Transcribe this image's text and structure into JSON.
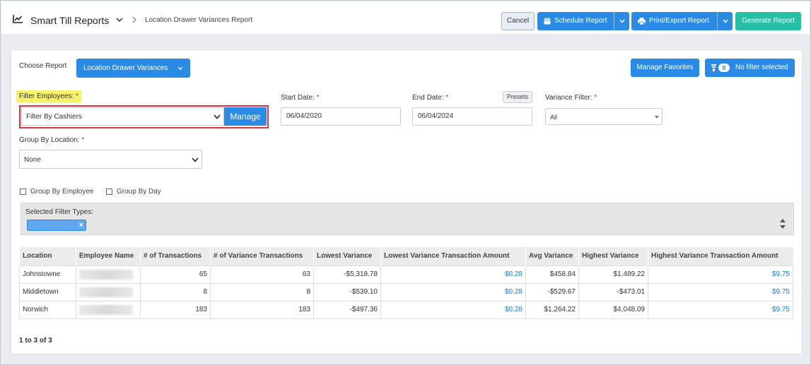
{
  "header": {
    "app_title": "Smart Till Reports",
    "breadcrumb": "Location Drawer Variances Report",
    "cancel_label": "Cancel",
    "schedule_label": "Schedule Report",
    "print_label": "Print/Export Report",
    "generate_label": "Generate Report"
  },
  "report": {
    "choose_label": "Choose Report",
    "selected_report": "Location Drawer Variances",
    "manage_favorites_label": "Manage Favorites",
    "filter_count": "0",
    "filter_status": "No filter selected"
  },
  "form": {
    "filter_employees_label": "Filter Employees:",
    "filter_employees_value": "Filter By Cashiers",
    "manage_label": "Manage",
    "start_date_label": "Start Date:",
    "start_date_value": "06/04/2020",
    "end_date_label": "End Date:",
    "end_date_value": "06/04/2024",
    "presets_label": "Presets",
    "variance_filter_label": "Variance Filter:",
    "variance_filter_value": "All",
    "group_by_location_label": "Group By Location:",
    "group_by_location_value": "None",
    "required_mark": "*",
    "group_by_employee_label": "Group By Employee",
    "group_by_day_label": "Group By Day",
    "selected_filter_types_label": "Selected Filter Types:",
    "tag_remove": "×"
  },
  "table": {
    "columns": [
      "Location",
      "Employee Name",
      "# of Transactions",
      "# of Variance Transactions",
      "Lowest Variance",
      "Lowest Variance Transaction Amount",
      "Avg Variance",
      "Highest Variance",
      "Highest Variance Transaction Amount"
    ],
    "rows": [
      {
        "location": "Johnstowne",
        "transactions": "65",
        "variance_transactions": "63",
        "lowest_variance": "-$5,318.78",
        "lowest_amount": "$0.28",
        "avg_variance": "$458.84",
        "highest_variance": "$1,489.22",
        "highest_amount": "$9.75"
      },
      {
        "location": "Middletown",
        "transactions": "8",
        "variance_transactions": "8",
        "lowest_variance": "-$539.10",
        "lowest_amount": "$0.28",
        "avg_variance": "-$529.67",
        "highest_variance": "-$473.01",
        "highest_amount": "$9.75"
      },
      {
        "location": "Norwich",
        "transactions": "183",
        "variance_transactions": "183",
        "lowest_variance": "-$497.36",
        "lowest_amount": "$0.28",
        "avg_variance": "$1,264.22",
        "highest_variance": "$4,048.09",
        "highest_amount": "$9.75"
      }
    ],
    "pager": "1 to 3 of 3"
  },
  "colors": {
    "primary": "#2a8be6",
    "generate": "#26bfa7",
    "highlight": "#f6f26a",
    "red_box": "#e0323a"
  },
  "icons": [
    "chart-line-icon",
    "chevron-down-icon",
    "chevron-right-icon",
    "calendar-icon",
    "print-icon",
    "filter-icon",
    "caret-down-icon",
    "sort-updown-icon",
    "close-icon"
  ]
}
